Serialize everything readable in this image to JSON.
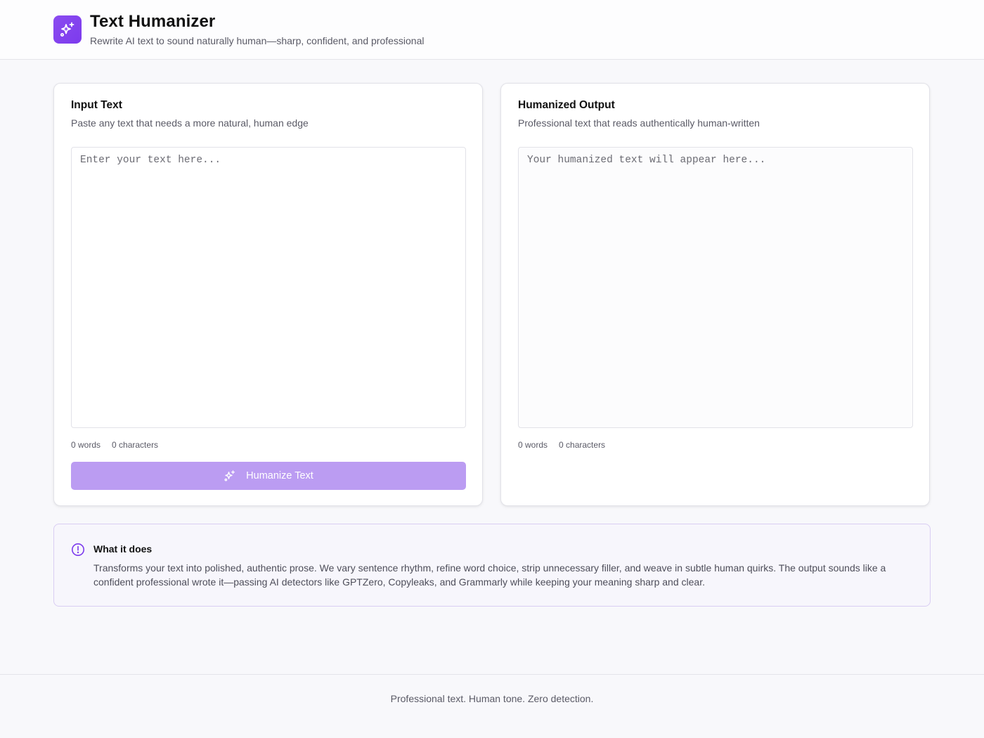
{
  "header": {
    "title": "Text Humanizer",
    "subtitle": "Rewrite AI text to sound naturally human—sharp, confident, and professional",
    "logo_icon": "sparkles-icon",
    "accent_color": "#7c3aed"
  },
  "input_card": {
    "title": "Input Text",
    "description": "Paste any text that needs a more natural, human edge",
    "placeholder": "Enter your text here...",
    "value": "",
    "word_count": "0 words",
    "char_count": "0 characters",
    "button_label": "Humanize Text",
    "button_icon": "sparkles-icon",
    "button_color": "#bb9cf2"
  },
  "output_card": {
    "title": "Humanized Output",
    "description": "Professional text that reads authentically human-written",
    "placeholder": "Your humanized text will appear here...",
    "value": "",
    "word_count": "0 words",
    "char_count": "0 characters"
  },
  "info": {
    "icon": "alert-circle-icon",
    "title": "What it does",
    "body": "Transforms your text into polished, authentic prose. We vary sentence rhythm, refine word choice, strip unnecessary filler, and weave in subtle human quirks. The output sounds like a confident professional wrote it—passing AI detectors like GPTZero, Copyleaks, and Grammarly while keeping your meaning sharp and clear."
  },
  "footer": {
    "text": "Professional text. Human tone. Zero detection."
  }
}
